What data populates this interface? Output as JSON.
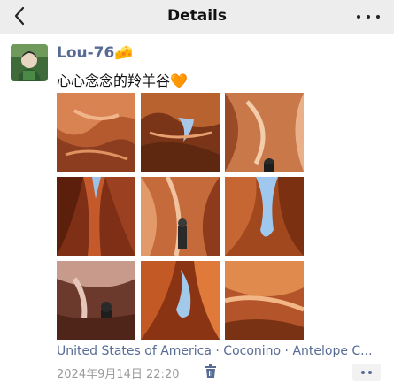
{
  "header": {
    "title": "Details",
    "back_icon": "chevron-left-icon",
    "more_icon": "more-dots-icon"
  },
  "post": {
    "username": "Lou-76",
    "username_emoji": "🧀",
    "text": "心心念念的羚羊谷",
    "text_emoji": "🧡",
    "photos": [
      {
        "label": "photo-1"
      },
      {
        "label": "photo-2"
      },
      {
        "label": "photo-3"
      },
      {
        "label": "photo-4"
      },
      {
        "label": "photo-5"
      },
      {
        "label": "photo-6"
      },
      {
        "label": "photo-7"
      },
      {
        "label": "photo-8"
      },
      {
        "label": "photo-9"
      }
    ],
    "location": "United States of America · Coconino · Antelope C...",
    "timestamp": "2024年9月14日 22:20",
    "delete_icon": "trash-icon",
    "comment_icon": "comment-dots-icon"
  },
  "colors": {
    "link_blue": "#576b95",
    "header_bg": "#ededed",
    "timestamp_gray": "#9a9a9a"
  }
}
